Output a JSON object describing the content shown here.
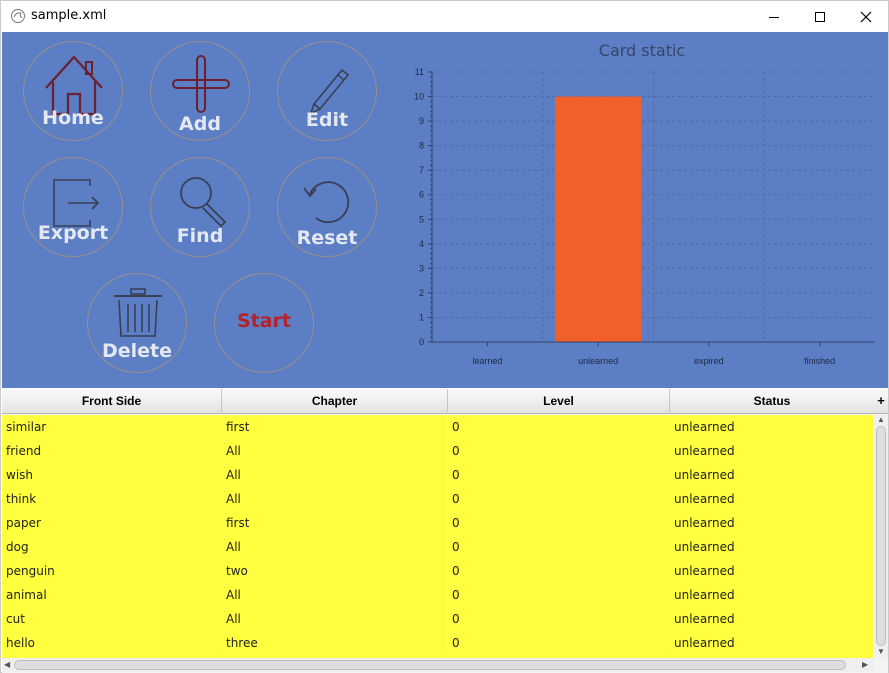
{
  "window": {
    "title": "sample.xml"
  },
  "icons": {
    "app": "app-icon",
    "minimize": "minimize-icon",
    "maximize": "maximize-icon",
    "close": "close-icon"
  },
  "buttons": {
    "home": "Home",
    "add": "Add",
    "edit": "Edit",
    "export": "Export",
    "find": "Find",
    "reset": "Reset",
    "delete": "Delete",
    "start": "Start"
  },
  "colors": {
    "panel": "#5b7ec4",
    "bar": "#f2602a",
    "row": "#ffff40",
    "start_label": "#b3232b"
  },
  "chart_data": {
    "type": "bar",
    "title": "Card static",
    "categories": [
      "learned",
      "unlearned",
      "expired",
      "finished"
    ],
    "values": [
      0,
      10,
      0,
      0
    ],
    "ylim": [
      0,
      11
    ],
    "yticks": [
      "0",
      "1",
      "2",
      "3",
      "4",
      "5",
      "6",
      "7",
      "8",
      "9",
      "10",
      "11"
    ],
    "grid": true,
    "xlabel": "",
    "ylabel": ""
  },
  "table": {
    "columns": [
      "Front Side",
      "Chapter",
      "Level",
      "Status"
    ],
    "corner": "+",
    "rows": [
      [
        "similar",
        "first",
        "0",
        "unlearned"
      ],
      [
        "friend",
        "All",
        "0",
        "unlearned"
      ],
      [
        "wish",
        "All",
        "0",
        "unlearned"
      ],
      [
        "think",
        "All",
        "0",
        "unlearned"
      ],
      [
        "paper",
        "first",
        "0",
        "unlearned"
      ],
      [
        "dog",
        "All",
        "0",
        "unlearned"
      ],
      [
        "penguin",
        "two",
        "0",
        "unlearned"
      ],
      [
        "animal",
        "All",
        "0",
        "unlearned"
      ],
      [
        "cut",
        "All",
        "0",
        "unlearned"
      ],
      [
        "hello",
        "three",
        "0",
        "unlearned"
      ]
    ]
  }
}
